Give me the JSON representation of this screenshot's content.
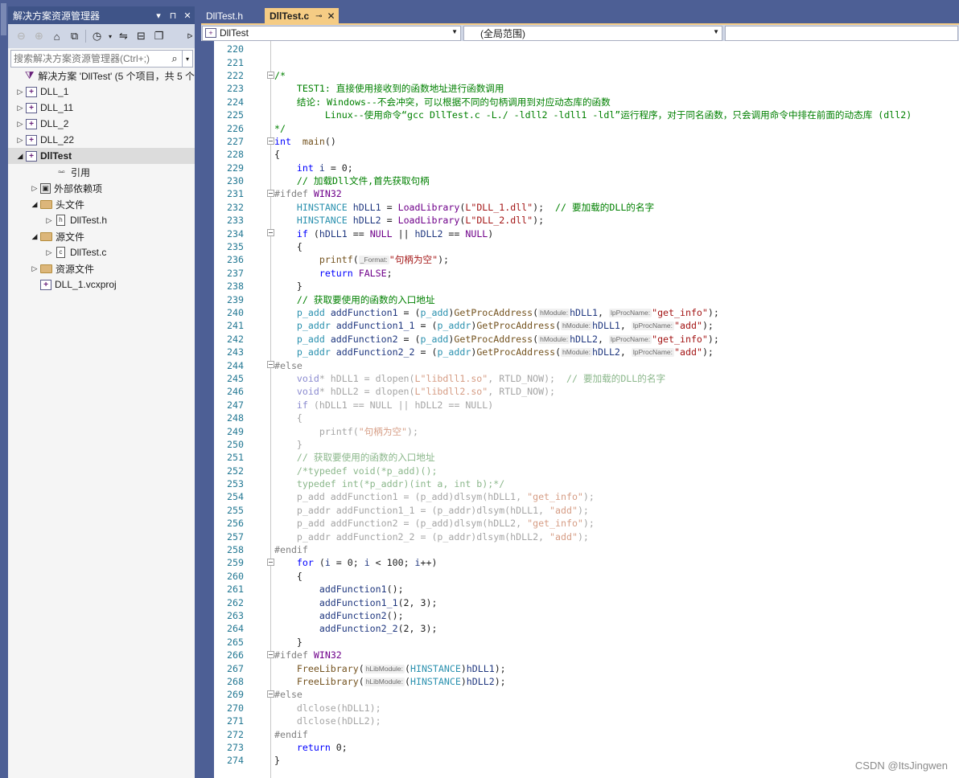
{
  "solution_explorer": {
    "title": "解决方案资源管理器",
    "title_icons": [
      "▾",
      "⊓",
      "✕"
    ],
    "search_placeholder": "搜索解决方案资源管理器(Ctrl+;)",
    "tree": [
      {
        "label": "解决方案 'DllTest' (5 个项目，共 5 个",
        "icon": "solution-icon",
        "indent": 0,
        "arrow": ""
      },
      {
        "label": "DLL_1",
        "icon": "cpp-project-icon",
        "indent": 0,
        "arrow": "▷"
      },
      {
        "label": "DLL_11",
        "icon": "cpp-project-icon",
        "indent": 0,
        "arrow": "▷"
      },
      {
        "label": "DLL_2",
        "icon": "cpp-project-icon",
        "indent": 0,
        "arrow": "▷"
      },
      {
        "label": "DLL_22",
        "icon": "cpp-project-icon",
        "indent": 0,
        "arrow": "▷"
      },
      {
        "label": "DllTest",
        "icon": "cpp-project-icon",
        "indent": 0,
        "arrow": "◢",
        "selected": true
      },
      {
        "label": "引用",
        "icon": "references-icon",
        "indent": 2,
        "arrow": ""
      },
      {
        "label": "外部依赖项",
        "icon": "external-dependencies-icon",
        "indent": 1,
        "arrow": "▷"
      },
      {
        "label": "头文件",
        "icon": "folder-icon",
        "indent": 1,
        "arrow": "◢"
      },
      {
        "label": "DllTest.h",
        "icon": "header-file-icon",
        "indent": 2,
        "arrow": "▷"
      },
      {
        "label": "源文件",
        "icon": "folder-icon",
        "indent": 1,
        "arrow": "◢"
      },
      {
        "label": "DllTest.c",
        "icon": "c-file-icon",
        "indent": 2,
        "arrow": "▷"
      },
      {
        "label": "资源文件",
        "icon": "folder-icon",
        "indent": 1,
        "arrow": "▷"
      },
      {
        "label": "DLL_1.vcxproj",
        "icon": "cpp-project-icon",
        "indent": 1,
        "arrow": ""
      }
    ]
  },
  "tabs": [
    {
      "label": "DllTest.h",
      "active": false
    },
    {
      "label": "DllTest.c",
      "active": true,
      "pin": "⊸",
      "close": "✕"
    }
  ],
  "navbar": {
    "project": "DllTest",
    "scope": "(全局范围)",
    "member": ""
  },
  "watermark": "CSDN @ItsJingwen",
  "colors": {
    "accent_tab": "#f5cc84",
    "frame": "#4d5f95",
    "keyword": "#0000ff",
    "comment": "#008000",
    "string": "#a31515",
    "type": "#2b91af",
    "macro": "#6f008a"
  },
  "code": [
    {
      "n": "220",
      "f": "",
      "t": []
    },
    {
      "n": "221",
      "f": "",
      "t": []
    },
    {
      "n": "222",
      "f": "⊟",
      "t": [
        [
          "cmt",
          "/*"
        ]
      ]
    },
    {
      "n": "223",
      "f": "",
      "t": [
        [
          "cmt",
          "    TEST1: 直接使用接收到的函数地址进行函数调用"
        ]
      ]
    },
    {
      "n": "224",
      "f": "",
      "t": [
        [
          "cmt",
          "    结论: Windows--不会冲突，可以根据不同的句柄调用到对应动态库的函数"
        ]
      ]
    },
    {
      "n": "225",
      "f": "",
      "t": [
        [
          "cmt",
          "         Linux--使用命令“gcc DllTest.c -L./ -ldll2 -ldll1 -ldl”运行程序，对于同名函数，只会调用命令中排在前面的动态库 (dll2)"
        ]
      ]
    },
    {
      "n": "226",
      "f": "",
      "t": [
        [
          "cmt",
          "*/"
        ]
      ]
    },
    {
      "n": "227",
      "f": "⊟",
      "t": [
        [
          "kw",
          "int"
        ],
        [
          "",
          "  "
        ],
        [
          "fn",
          "main"
        ],
        [
          "",
          "()"
        ]
      ]
    },
    {
      "n": "228",
      "f": "",
      "t": [
        [
          "",
          "{"
        ]
      ]
    },
    {
      "n": "229",
      "f": "",
      "t": [
        [
          "",
          "    "
        ],
        [
          "kw",
          "int"
        ],
        [
          "",
          " "
        ],
        [
          "id",
          "i"
        ],
        [
          "",
          " = 0;"
        ]
      ]
    },
    {
      "n": "230",
      "f": "",
      "t": [
        [
          "",
          "    "
        ],
        [
          "cmt",
          "// 加载Dll文件,首先获取句柄"
        ]
      ]
    },
    {
      "n": "231",
      "f": "⊟",
      "t": [
        [
          "pre",
          "#ifdef "
        ],
        [
          "mac",
          "WIN32"
        ]
      ]
    },
    {
      "n": "232",
      "f": "",
      "t": [
        [
          "",
          "    "
        ],
        [
          "ty",
          "HINSTANCE"
        ],
        [
          "",
          " "
        ],
        [
          "id",
          "hDLL1"
        ],
        [
          "",
          " = "
        ],
        [
          "mac",
          "LoadLibrary"
        ],
        [
          "",
          "("
        ],
        [
          "str",
          "L\"DLL_1.dll\""
        ],
        [
          "",
          ");  "
        ],
        [
          "cmt",
          "// 要加载的DLL的名字"
        ]
      ]
    },
    {
      "n": "233",
      "f": "",
      "t": [
        [
          "",
          "    "
        ],
        [
          "ty",
          "HINSTANCE"
        ],
        [
          "",
          " "
        ],
        [
          "id",
          "hDLL2"
        ],
        [
          "",
          " = "
        ],
        [
          "mac",
          "LoadLibrary"
        ],
        [
          "",
          "("
        ],
        [
          "str",
          "L\"DLL_2.dll\""
        ],
        [
          "",
          ");"
        ]
      ]
    },
    {
      "n": "234",
      "f": "⊟",
      "t": [
        [
          "",
          "    "
        ],
        [
          "kw",
          "if"
        ],
        [
          "",
          " ("
        ],
        [
          "id",
          "hDLL1"
        ],
        [
          "",
          " == "
        ],
        [
          "mac",
          "NULL"
        ],
        [
          "",
          " || "
        ],
        [
          "id",
          "hDLL2"
        ],
        [
          "",
          " == "
        ],
        [
          "mac",
          "NULL"
        ],
        [
          "",
          ")"
        ]
      ]
    },
    {
      "n": "235",
      "f": "",
      "t": [
        [
          "",
          "    {"
        ]
      ]
    },
    {
      "n": "236",
      "f": "",
      "t": [
        [
          "",
          "        "
        ],
        [
          "fn",
          "printf"
        ],
        [
          "",
          "("
        ],
        [
          "hint",
          "_Format:"
        ],
        [
          "str",
          "\"句柄为空\""
        ],
        [
          "",
          ");"
        ]
      ]
    },
    {
      "n": "237",
      "f": "",
      "t": [
        [
          "",
          "        "
        ],
        [
          "kw",
          "return"
        ],
        [
          "",
          " "
        ],
        [
          "mac",
          "FALSE"
        ],
        [
          "",
          ";"
        ]
      ]
    },
    {
      "n": "238",
      "f": "",
      "t": [
        [
          "",
          "    }"
        ]
      ]
    },
    {
      "n": "239",
      "f": "",
      "t": [
        [
          "",
          "    "
        ],
        [
          "cmt",
          "// 获取要使用的函数的入口地址"
        ]
      ]
    },
    {
      "n": "240",
      "f": "",
      "t": [
        [
          "",
          "    "
        ],
        [
          "ty",
          "p_add"
        ],
        [
          "",
          " "
        ],
        [
          "id",
          "addFunction1"
        ],
        [
          "",
          " = ("
        ],
        [
          "ty",
          "p_add"
        ],
        [
          "",
          ")"
        ],
        [
          "fn",
          "GetProcAddress"
        ],
        [
          "",
          "("
        ],
        [
          "hint",
          "hModule:"
        ],
        [
          "id",
          "hDLL1"
        ],
        [
          ",",
          ", "
        ],
        [
          "hint",
          "lpProcName:"
        ],
        [
          "str",
          "\"get_info\""
        ],
        [
          "",
          ");"
        ]
      ]
    },
    {
      "n": "241",
      "f": "",
      "t": [
        [
          "",
          "    "
        ],
        [
          "ty",
          "p_addr"
        ],
        [
          "",
          " "
        ],
        [
          "id",
          "addFunction1_1"
        ],
        [
          "",
          " = ("
        ],
        [
          "ty",
          "p_addr"
        ],
        [
          "",
          ")"
        ],
        [
          "fn",
          "GetProcAddress"
        ],
        [
          "",
          "("
        ],
        [
          "hint",
          "hModule:"
        ],
        [
          "id",
          "hDLL1"
        ],
        [
          "",
          ", "
        ],
        [
          "hint",
          "lpProcName:"
        ],
        [
          "str",
          "\"add\""
        ],
        [
          "",
          ");"
        ]
      ]
    },
    {
      "n": "242",
      "f": "",
      "t": [
        [
          "",
          "    "
        ],
        [
          "ty",
          "p_add"
        ],
        [
          "",
          " "
        ],
        [
          "id",
          "addFunction2"
        ],
        [
          "",
          " = ("
        ],
        [
          "ty",
          "p_add"
        ],
        [
          "",
          ")"
        ],
        [
          "fn",
          "GetProcAddress"
        ],
        [
          "",
          "("
        ],
        [
          "hint",
          "hModule:"
        ],
        [
          "id",
          "hDLL2"
        ],
        [
          "",
          ", "
        ],
        [
          "hint",
          "lpProcName:"
        ],
        [
          "str",
          "\"get_info\""
        ],
        [
          "",
          ");"
        ]
      ]
    },
    {
      "n": "243",
      "f": "",
      "t": [
        [
          "",
          "    "
        ],
        [
          "ty",
          "p_addr"
        ],
        [
          "",
          " "
        ],
        [
          "id",
          "addFunction2_2"
        ],
        [
          "",
          " = ("
        ],
        [
          "ty",
          "p_addr"
        ],
        [
          "",
          ")"
        ],
        [
          "fn",
          "GetProcAddress"
        ],
        [
          "",
          "("
        ],
        [
          "hint",
          "hModule:"
        ],
        [
          "id",
          "hDLL2"
        ],
        [
          "",
          ", "
        ],
        [
          "hint",
          "lpProcName:"
        ],
        [
          "str",
          "\"add\""
        ],
        [
          "",
          ");"
        ]
      ]
    },
    {
      "n": "244",
      "f": "⊟",
      "t": [
        [
          "pre",
          "#else"
        ]
      ]
    },
    {
      "n": "245",
      "f": "",
      "t": [
        [
          "",
          "    "
        ],
        [
          "grk",
          "void"
        ],
        [
          "gr",
          "* hDLL1 = dlopen("
        ],
        [
          "grs",
          "L\"libdll1.so\""
        ],
        [
          "gr",
          ", RTLD_NOW);  "
        ],
        [
          "grc",
          "// 要加载的DLL的名字"
        ]
      ]
    },
    {
      "n": "246",
      "f": "",
      "t": [
        [
          "",
          "    "
        ],
        [
          "grk",
          "void"
        ],
        [
          "gr",
          "* hDLL2 = dlopen("
        ],
        [
          "grs",
          "L\"libdll2.so\""
        ],
        [
          "gr",
          ", RTLD_NOW);"
        ]
      ]
    },
    {
      "n": "247",
      "f": "",
      "t": [
        [
          "",
          "    "
        ],
        [
          "grk",
          "if"
        ],
        [
          "gr",
          " (hDLL1 == NULL || hDLL2 == NULL)"
        ]
      ]
    },
    {
      "n": "248",
      "f": "",
      "t": [
        [
          "gr",
          "    {"
        ]
      ]
    },
    {
      "n": "249",
      "f": "",
      "t": [
        [
          "gr",
          "        printf("
        ],
        [
          "grs",
          "\"句柄为空\""
        ],
        [
          "gr",
          ");"
        ]
      ]
    },
    {
      "n": "250",
      "f": "",
      "t": [
        [
          "gr",
          "    }"
        ]
      ]
    },
    {
      "n": "251",
      "f": "",
      "t": [
        [
          "",
          "    "
        ],
        [
          "grc",
          "// 获取要使用的函数的入口地址"
        ]
      ]
    },
    {
      "n": "252",
      "f": "",
      "t": [
        [
          "",
          "    "
        ],
        [
          "grc",
          "/*typedef void(*p_add)();"
        ]
      ]
    },
    {
      "n": "253",
      "f": "",
      "t": [
        [
          "",
          "    "
        ],
        [
          "grc",
          "typedef int(*p_addr)(int a, int b);*/"
        ]
      ]
    },
    {
      "n": "254",
      "f": "",
      "t": [
        [
          "gr",
          "    p_add addFunction1 = (p_add)dlsym(hDLL1, "
        ],
        [
          "grs",
          "\"get_info\""
        ],
        [
          "gr",
          ");"
        ]
      ]
    },
    {
      "n": "255",
      "f": "",
      "t": [
        [
          "gr",
          "    p_addr addFunction1_1 = (p_addr)dlsym(hDLL1, "
        ],
        [
          "grs",
          "\"add\""
        ],
        [
          "gr",
          ");"
        ]
      ]
    },
    {
      "n": "256",
      "f": "",
      "t": [
        [
          "gr",
          "    p_add addFunction2 = (p_add)dlsym(hDLL2, "
        ],
        [
          "grs",
          "\"get_info\""
        ],
        [
          "gr",
          ");"
        ]
      ]
    },
    {
      "n": "257",
      "f": "",
      "t": [
        [
          "gr",
          "    p_addr addFunction2_2 = (p_addr)dlsym(hDLL2, "
        ],
        [
          "grs",
          "\"add\""
        ],
        [
          "gr",
          ");"
        ]
      ]
    },
    {
      "n": "258",
      "f": "",
      "t": [
        [
          "pre",
          "#endif"
        ]
      ]
    },
    {
      "n": "259",
      "f": "⊟",
      "t": [
        [
          "",
          "    "
        ],
        [
          "kw",
          "for"
        ],
        [
          "",
          " ("
        ],
        [
          "id",
          "i"
        ],
        [
          "",
          " = 0; "
        ],
        [
          "id",
          "i"
        ],
        [
          "",
          " < 100; "
        ],
        [
          "id",
          "i"
        ],
        [
          "",
          "++)"
        ]
      ]
    },
    {
      "n": "260",
      "f": "",
      "t": [
        [
          "",
          "    {"
        ]
      ]
    },
    {
      "n": "261",
      "f": "",
      "t": [
        [
          "",
          "        "
        ],
        [
          "id",
          "addFunction1"
        ],
        [
          "",
          "();"
        ]
      ]
    },
    {
      "n": "262",
      "f": "",
      "t": [
        [
          "",
          "        "
        ],
        [
          "id",
          "addFunction1_1"
        ],
        [
          "",
          "(2, 3);"
        ]
      ]
    },
    {
      "n": "263",
      "f": "",
      "t": [
        [
          "",
          "        "
        ],
        [
          "id",
          "addFunction2"
        ],
        [
          "",
          "();"
        ]
      ]
    },
    {
      "n": "264",
      "f": "",
      "t": [
        [
          "",
          "        "
        ],
        [
          "id",
          "addFunction2_2"
        ],
        [
          "",
          "(2, 3);"
        ]
      ]
    },
    {
      "n": "265",
      "f": "",
      "t": [
        [
          "",
          "    }"
        ]
      ]
    },
    {
      "n": "266",
      "f": "⊟",
      "t": [
        [
          "pre",
          "#ifdef "
        ],
        [
          "mac",
          "WIN32"
        ]
      ]
    },
    {
      "n": "267",
      "f": "",
      "t": [
        [
          "",
          "    "
        ],
        [
          "fn",
          "FreeLibrary"
        ],
        [
          "",
          "("
        ],
        [
          "hint",
          "hLibModule:"
        ],
        [
          "",
          "("
        ],
        [
          "ty",
          "HINSTANCE"
        ],
        [
          "",
          ")"
        ],
        [
          "id",
          "hDLL1"
        ],
        [
          "",
          ");"
        ]
      ]
    },
    {
      "n": "268",
      "f": "",
      "t": [
        [
          "",
          "    "
        ],
        [
          "fn",
          "FreeLibrary"
        ],
        [
          "",
          "("
        ],
        [
          "hint",
          "hLibModule:"
        ],
        [
          "",
          "("
        ],
        [
          "ty",
          "HINSTANCE"
        ],
        [
          "",
          ")"
        ],
        [
          "id",
          "hDLL2"
        ],
        [
          "",
          ");"
        ]
      ]
    },
    {
      "n": "269",
      "f": "⊟",
      "t": [
        [
          "pre",
          "#else"
        ]
      ]
    },
    {
      "n": "270",
      "f": "",
      "t": [
        [
          "gr",
          "    dlclose(hDLL1);"
        ]
      ]
    },
    {
      "n": "271",
      "f": "",
      "t": [
        [
          "gr",
          "    dlclose(hDLL2);"
        ]
      ]
    },
    {
      "n": "272",
      "f": "",
      "t": [
        [
          "pre",
          "#endif"
        ]
      ]
    },
    {
      "n": "273",
      "f": "",
      "t": [
        [
          "",
          "    "
        ],
        [
          "kw",
          "return"
        ],
        [
          "",
          ""
        ],
        [
          "",
          " 0;"
        ]
      ]
    },
    {
      "n": "274",
      "f": "",
      "t": [
        [
          "",
          "}"
        ]
      ]
    }
  ]
}
